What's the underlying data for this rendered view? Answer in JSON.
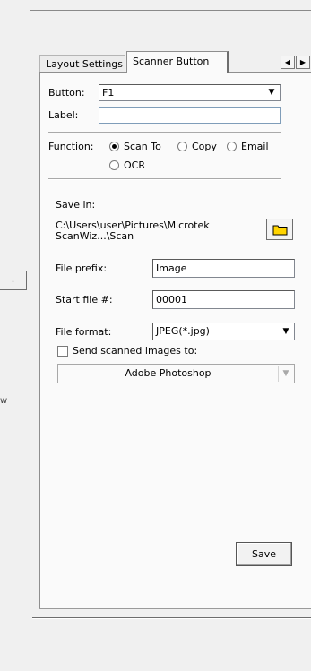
{
  "tabs": [
    {
      "label": "Layout Settings"
    },
    {
      "label": "Scanner Button",
      "active": true
    }
  ],
  "tab_scroll": {
    "left_arrow": "◀",
    "right_arrow": "▶"
  },
  "button_row": {
    "label": "Button:",
    "value": "F1"
  },
  "label_row": {
    "label": "Label:",
    "value": ""
  },
  "function": {
    "label": "Function:",
    "options": [
      "Scan To",
      "Copy",
      "Email",
      "OCR"
    ],
    "selected": "Scan To"
  },
  "save_in": {
    "label": "Save in:",
    "path_line1": "C:\\Users\\user\\Pictures\\Microtek",
    "path_line2": "ScanWiz...\\Scan"
  },
  "file_prefix": {
    "label": "File prefix:",
    "value": "Image"
  },
  "start_file": {
    "label": "Start file #:",
    "value": "00001"
  },
  "file_format": {
    "label": "File format:",
    "value": "JPEG(*.jpg)"
  },
  "send_to": {
    "label": "Send scanned images to:",
    "checked": false,
    "target": "Adobe Photoshop"
  },
  "save_button": "Save",
  "left_artifacts": {
    "button_text": ".",
    "stray_text": "w"
  },
  "colors": {
    "folder_yellow": "#ffd400",
    "page_bg": "#fafafa",
    "window_bg": "#f0f0f0"
  }
}
